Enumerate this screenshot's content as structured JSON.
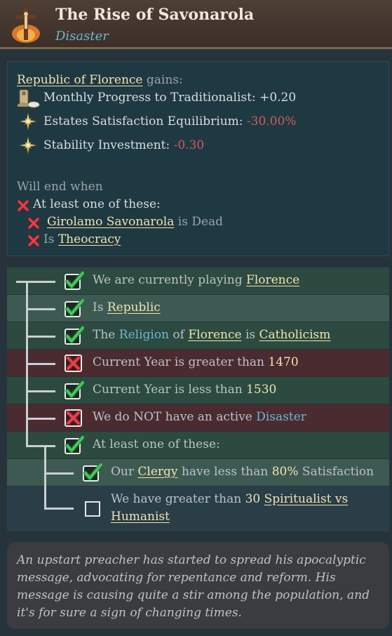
{
  "header": {
    "title": "The Rise of Savonarola",
    "subtitle": "Disaster",
    "icon": "crucifix-icon"
  },
  "effects": {
    "target": "Republic of Florence",
    "gains_label": " gains:",
    "modifiers": [
      {
        "icon": "traditionalist-scroll-icon",
        "label": "Monthly Progress to Traditionalist: ",
        "value": "+0.20"
      },
      {
        "icon": "gold-star-icon",
        "label": "Estates Satisfaction Equilibrium: ",
        "value": "-30.00%"
      },
      {
        "icon": "gold-star-icon",
        "label": "Stability Investment: ",
        "value": "-0.30"
      }
    ],
    "end_when_label": "Will end when",
    "at_least_one": "At least one of these:",
    "end_conditions": [
      {
        "link": "Girolamo Savonarola",
        "suffix": " is Dead"
      },
      {
        "prefix": "Is ",
        "link": "Theocracy"
      }
    ]
  },
  "trigger": {
    "rows": [
      {
        "status": "met",
        "parts": [
          "We are currently playing ",
          "Florence"
        ]
      },
      {
        "status": "met",
        "parts": [
          "Is ",
          "Republic"
        ]
      },
      {
        "status": "met",
        "parts": [
          "The ",
          "Religion",
          " of ",
          "Florence",
          " is ",
          "Catholicism"
        ]
      },
      {
        "status": "failed",
        "parts": [
          "Current Year is greater than ",
          "1470"
        ]
      },
      {
        "status": "met",
        "parts": [
          "Current Year is less than ",
          "1530"
        ]
      },
      {
        "status": "failed",
        "parts": [
          "We do NOT have an active ",
          "Disaster"
        ]
      },
      {
        "status": "met",
        "parts": [
          "At least one of these:"
        ]
      },
      {
        "status": "met",
        "parts": [
          "Our ",
          "Clergy",
          " have less than ",
          "80%",
          " Satisfaction"
        ]
      },
      {
        "status": "unmet",
        "parts": [
          "We have greater than ",
          "30",
          " ",
          "Spiritualist vs",
          "Humanist"
        ]
      }
    ]
  },
  "description": "An upstart preacher has started to spread his apocalyptic message, advocating for repentance and reform. His message is causing quite a stir among the population, and it's for sure a sign of changing times.",
  "colors": {
    "met": "#2fa84a",
    "failed": "#c8323a",
    "link": "#f1e3b0",
    "blue_link": "#6fb6cf"
  }
}
